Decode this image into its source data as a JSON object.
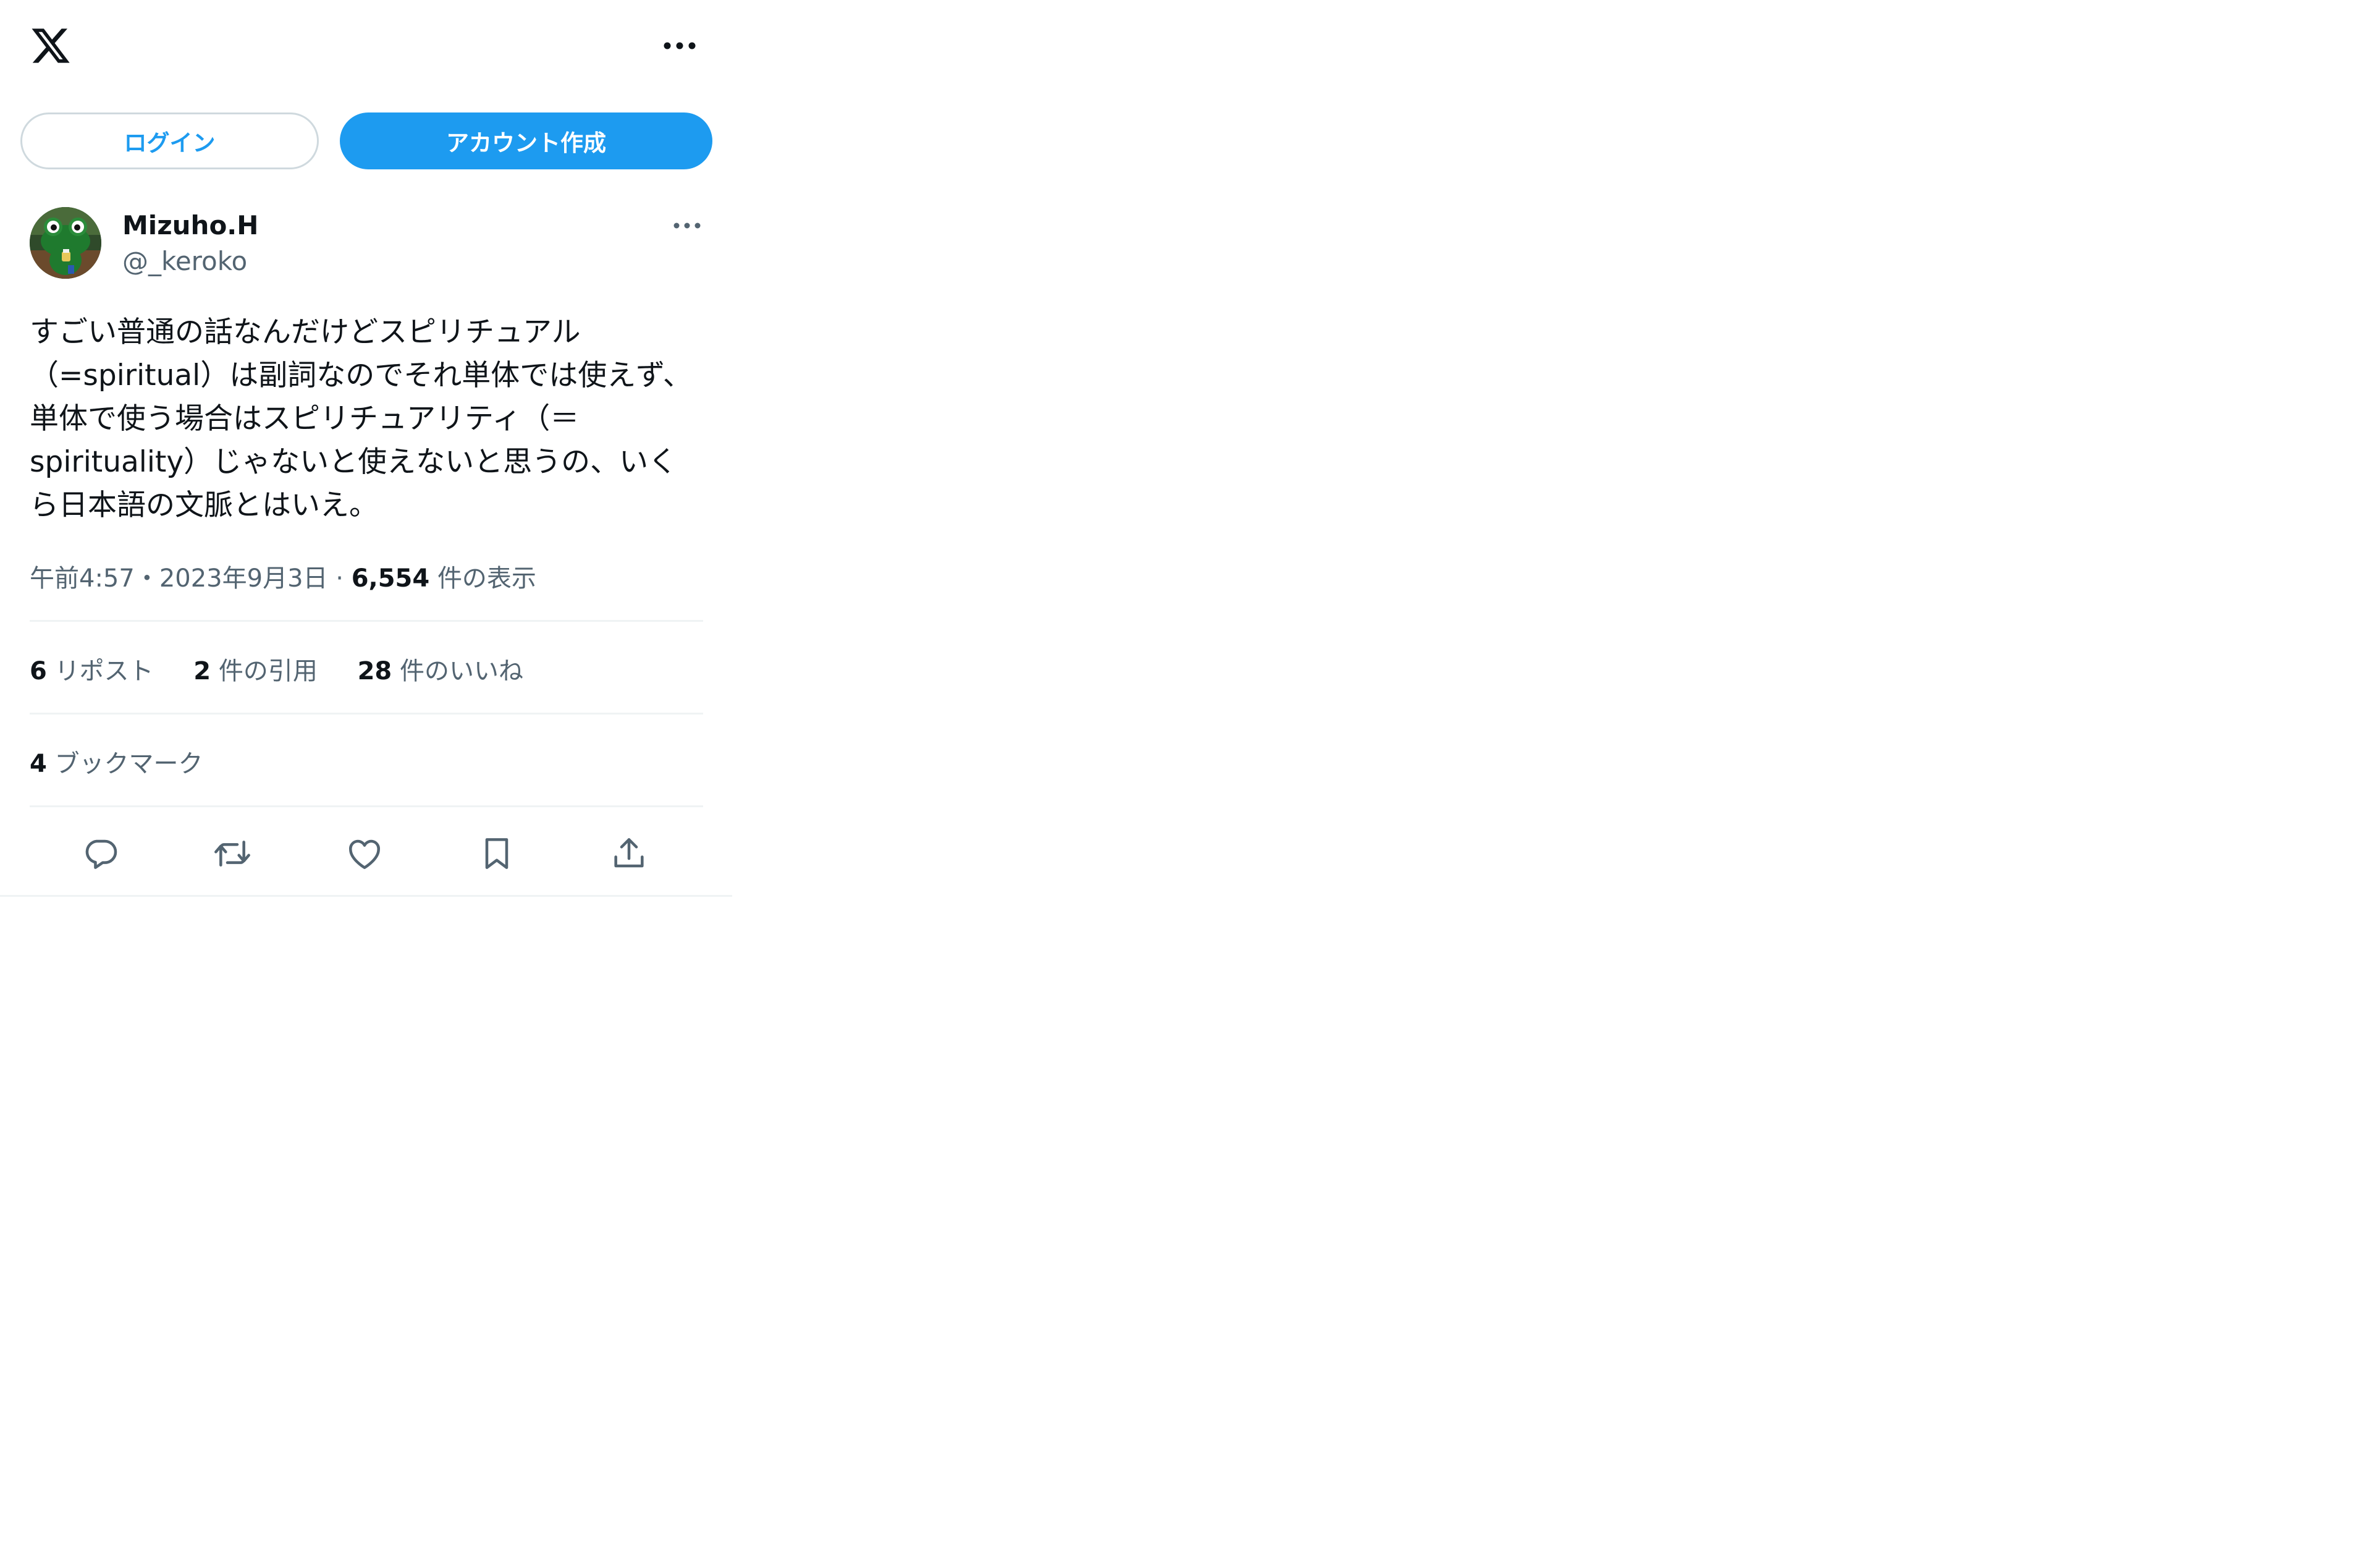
{
  "header": {
    "logo_icon": "x-logo-icon",
    "more_icon": "more-horizontal-icon"
  },
  "auth": {
    "login_label": "ログイン",
    "signup_label": "アカウント作成"
  },
  "tweet": {
    "author": {
      "name": "Mizuho.H",
      "handle": "@_keroko"
    },
    "text_lines": [
      "すごい普通の話なんだけどスピリチュアル",
      "（=spiritual）は副詞なのでそれ単体では使えず、",
      "単体で使う場合はスピリチュアリティ（＝",
      "spirituality）じゃないと使えないと思うの、いく",
      "ら日本語の文脈とはいえ。"
    ],
    "time": "午前4:57",
    "date": "2023年9月3日",
    "separator": "・",
    "dot": "·",
    "views_count": "6,554",
    "views_label": "件の表示",
    "stats": {
      "reposts": {
        "count": "6",
        "label": "リポスト"
      },
      "quotes": {
        "count": "2",
        "label": "件の引用"
      },
      "likes": {
        "count": "28",
        "label": "件のいいね"
      },
      "bookmarks": {
        "count": "4",
        "label": "ブックマーク"
      }
    },
    "actions": [
      "reply-icon",
      "repost-icon",
      "like-icon",
      "bookmark-icon",
      "share-icon"
    ]
  },
  "colors": {
    "accent": "#1d9bf0",
    "text_primary": "#0f1419",
    "text_secondary": "#536471",
    "border": "#cfd9de",
    "divider": "#eff3f4"
  }
}
